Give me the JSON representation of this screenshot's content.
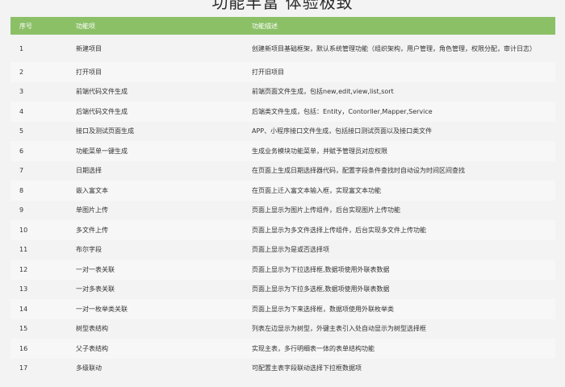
{
  "title": "功能丰富 体验极致",
  "table": {
    "headers": [
      "序号",
      "功能项",
      "功能描述"
    ],
    "rows": [
      {
        "no": "1",
        "item": "新建项目",
        "desc": "创建新项目基础框架，默认系统管理功能（组织架构，用户管理，角色管理，权限分配，审计日志）"
      },
      {
        "no": "2",
        "item": "打开项目",
        "desc": "打开旧项目"
      },
      {
        "no": "3",
        "item": "前端代码文件生成",
        "desc": "前端页面文件生成，包括new,edit,view,list,sort"
      },
      {
        "no": "4",
        "item": "后端代码文件生成",
        "desc": "后端类文件生成，包括：Entity，Contorller,Mapper,Service"
      },
      {
        "no": "5",
        "item": "接口及测试页面生成",
        "desc": "APP、小程序接口文件生成，包括接口测试页面以及接口类文件"
      },
      {
        "no": "6",
        "item": "功能菜单一键生成",
        "desc": "生成业务模块功能菜单，并赋予管理员对应权限"
      },
      {
        "no": "7",
        "item": "日期选择",
        "desc": "在页面上生成日期选择器代码，配置字段条件查找时自动设为时间区间查找"
      },
      {
        "no": "8",
        "item": "嵌入富文本",
        "desc": "在页面上迁入富文本输入框，实现富文本功能"
      },
      {
        "no": "9",
        "item": "单图片上传",
        "desc": "页面上显示为图片上传组件，后台实现图片上传功能"
      },
      {
        "no": "10",
        "item": "多文件上传",
        "desc": "页面上显示为多文件选择上传组件，后台实现多文件上传功能"
      },
      {
        "no": "11",
        "item": "布尔字段",
        "desc": "页面上显示为是或否选择项"
      },
      {
        "no": "12",
        "item": "一对一表关联",
        "desc": "页面上显示为下拉选择框,数据项使用外联表数据"
      },
      {
        "no": "13",
        "item": "一对多表关联",
        "desc": "页面上显示为下拉多选框,数据项使用外联表数据"
      },
      {
        "no": "14",
        "item": "一对一枚举类关联",
        "desc": "页面上显示为下来选择框，数据项使用外联枚举类"
      },
      {
        "no": "15",
        "item": "树型表结构",
        "desc": "列表左边显示为树型，外键主表引入处自动显示为树型选择框"
      },
      {
        "no": "16",
        "item": "父子表结构",
        "desc": "实现主表，多行明细表一体的表单结构功能"
      },
      {
        "no": "17",
        "item": "多级联动",
        "desc": "可配置主表字段联动选择下拉框数据项"
      }
    ]
  },
  "colors": {
    "header_bg": "#8bc067",
    "header_text": "#ffffff",
    "page_bg": "#f3f3f3"
  }
}
